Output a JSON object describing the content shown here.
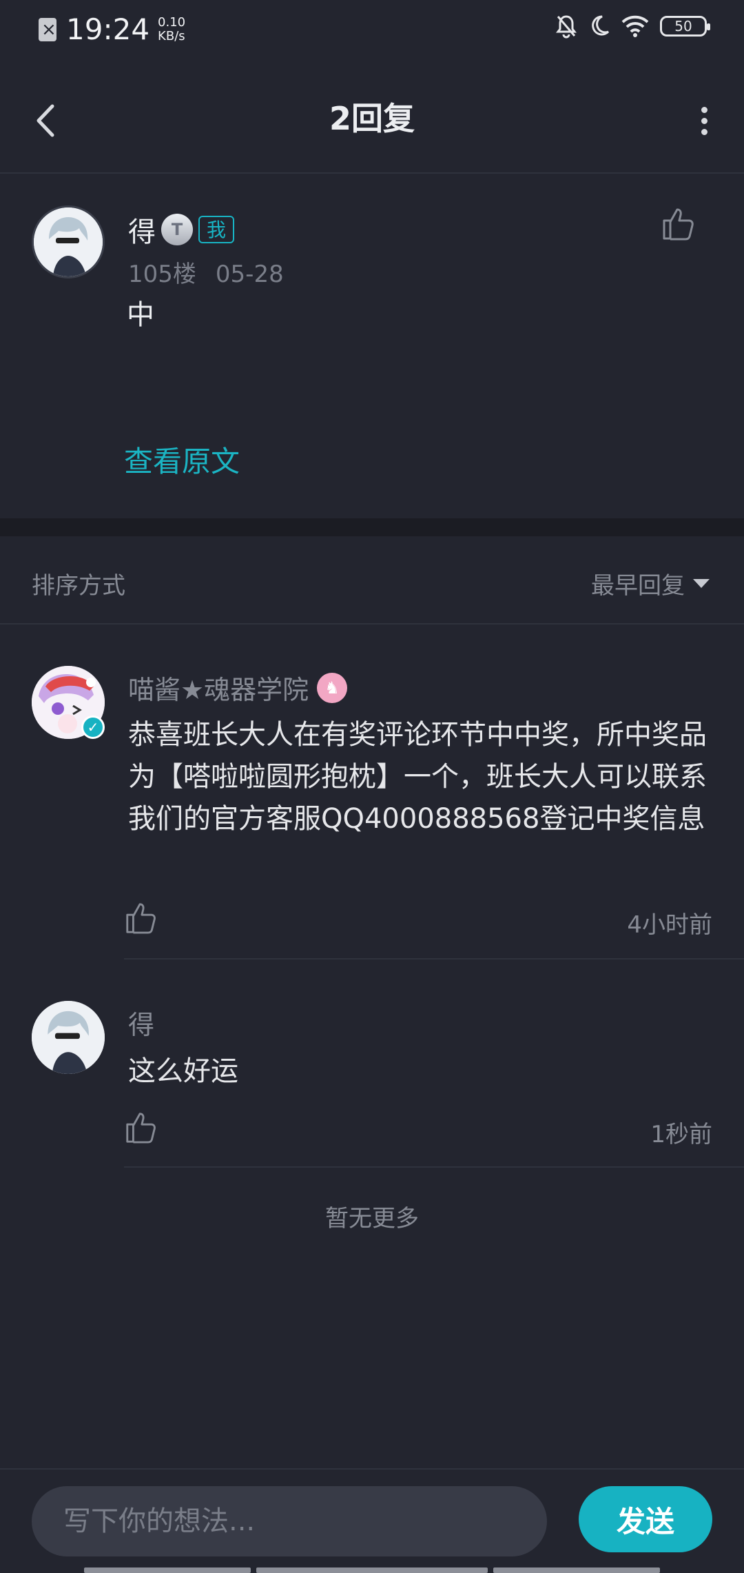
{
  "status_bar": {
    "time": "19:24",
    "net_speed_value": "0.10",
    "net_speed_unit": "KB/s",
    "battery": "50"
  },
  "header": {
    "title": "2回复"
  },
  "original_post": {
    "author": "得",
    "level_badge": "T",
    "me_tag": "我",
    "floor": "105楼",
    "date": "05-28",
    "content": "中",
    "view_original": "查看原文"
  },
  "sort": {
    "label": "排序方式",
    "selected": "最早回复"
  },
  "replies": [
    {
      "author": "喵酱★魂器学院",
      "text": "恭喜班长大人在有奖评论环节中中奖，所中奖品为【嗒啦啦圆形抱枕】一个，班长大人可以联系我们的官方客服QQ4000888568登记中奖信息",
      "time": "4小时前"
    },
    {
      "author": "得",
      "text": "这么好运",
      "time": "1秒前"
    }
  ],
  "footer_note": "暂无更多",
  "composer": {
    "placeholder": "写下你的想法...",
    "send_label": "发送"
  },
  "colors": {
    "background": "#23252f",
    "accent": "#17b2c2",
    "muted_text": "#878b95"
  }
}
